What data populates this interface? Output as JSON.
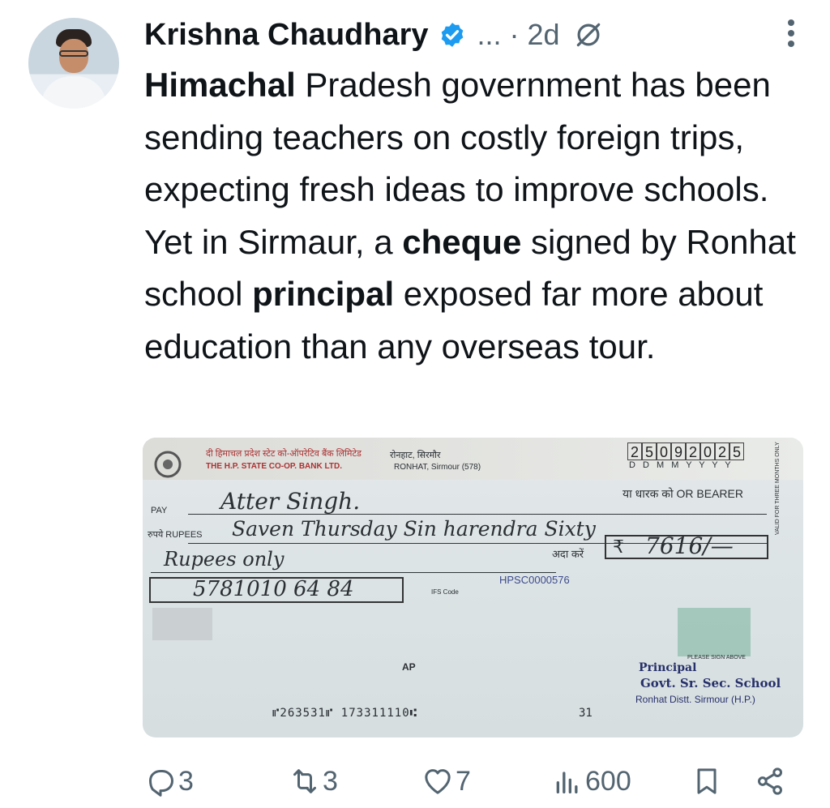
{
  "author": {
    "name": "Krishna Chaudhary",
    "meta": "... · 2d"
  },
  "tweet": {
    "parts": [
      {
        "text": "Himachal",
        "bold": true
      },
      {
        "text": " Pradesh government has been sending teachers on costly foreign trips, expecting fresh ideas to improve schools. Yet in Sirmaur, a ",
        "bold": false
      },
      {
        "text": "cheque",
        "bold": true
      },
      {
        "text": " signed by Ronhat school ",
        "bold": false
      },
      {
        "text": "principal",
        "bold": true
      },
      {
        "text": " exposed far more about education than any overseas tour.",
        "bold": false
      }
    ]
  },
  "cheque": {
    "bank_hi": "दी हिमाचल प्रदेश स्टेट को-ऑपरेटिव बैंक लिमिटेड",
    "bank_en": "THE H.P. STATE CO-OP. BANK LTD.",
    "branch_hi": "रोनहाट, सिरमौर",
    "branch_en": "RONHAT, Sirmour (578)",
    "date_digits": [
      "2",
      "5",
      "0",
      "9",
      "2",
      "0",
      "2",
      "5"
    ],
    "date_format": "D D M M Y Y Y Y",
    "bearer": "या धारक को OR BEARER",
    "pay_label": "PAY",
    "payee": "Atter Singh.",
    "rupees_label": "रुपये RUPEES",
    "amount_words_1": "Saven Thursday Sin harendra Sixty",
    "amount_words_2": "Rupees only",
    "ada_karen": "अदा करें",
    "amount": "7616/—",
    "account_no": "5781010 64 84",
    "ifsc_label": "IFS Code",
    "ifsc": "HPSC0000576",
    "ap": "AP",
    "please_sign": "PLEASE SIGN ABOVE",
    "principal": "Principal",
    "school_line": "Govt. Sr. Sec. School",
    "district_line": "Ronhat Distt. Sirmour (H.P.)",
    "micr": "⑈263531⑈ 173311110⑆",
    "micr_code": "31",
    "side_text": "VALID FOR THREE MONTHS ONLY"
  },
  "actions": {
    "replies": "3",
    "reposts": "3",
    "likes": "7",
    "views": "600"
  },
  "colors": {
    "text": "#0f1419",
    "secondary": "#536471",
    "verified": "#1d9bf0"
  }
}
